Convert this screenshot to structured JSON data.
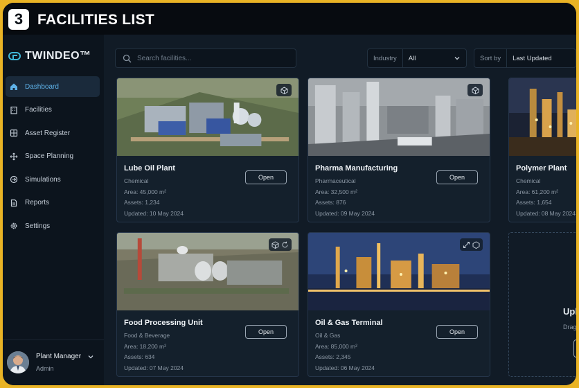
{
  "slide": {
    "step": "3",
    "title": "FACILITIES LIST"
  },
  "brand": {
    "name": "TWINDEO™"
  },
  "nav": [
    {
      "label": "Dashboard",
      "icon": "home-icon",
      "active": true
    },
    {
      "label": "Facilities",
      "icon": "building-icon",
      "active": false
    },
    {
      "label": "Asset Register",
      "icon": "database-icon",
      "active": false
    },
    {
      "label": "Space Planning",
      "icon": "expand-icon",
      "active": false
    },
    {
      "label": "Simulations",
      "icon": "simulation-icon",
      "active": false
    },
    {
      "label": "Reports",
      "icon": "document-icon",
      "active": false
    },
    {
      "label": "Settings",
      "icon": "gear-icon",
      "active": false
    }
  ],
  "user": {
    "name": "Plant Manager",
    "role": "Admin"
  },
  "search": {
    "placeholder": "Search facilities..."
  },
  "filters": {
    "industry": {
      "label": "Industry",
      "value": "All"
    },
    "sort": {
      "label": "Sort by",
      "value": "Last Updated"
    }
  },
  "open_label": "Open",
  "cards": [
    {
      "title": "Lube Oil Plant",
      "category": "Chemical",
      "area": "Area: 45,000 m²",
      "assets": "Assets: 1,234",
      "updated": "Updated: 10 May 2024",
      "badge_icon": "cube-icon"
    },
    {
      "title": "Pharma Manufacturing",
      "category": "Pharmaceutical",
      "area": "Area: 32,500 m²",
      "assets": "Assets: 876",
      "updated": "Updated: 09 May 2024",
      "badge_icon": "cube-icon"
    },
    {
      "title": "Polymer Plant",
      "category": "Chemical",
      "area": "Area: 61,200 m²",
      "assets": "Assets: 1,654",
      "updated": "Updated: 08 May 2024",
      "badge_icon": "cube-icon"
    },
    {
      "title": "Food Processing Unit",
      "category": "Food & Beverage",
      "area": "Area: 18,200 m²",
      "assets": "Assets: 634",
      "updated": "Updated: 07 May 2024",
      "badge_icon": "cube-icon"
    },
    {
      "title": "Oil & Gas Terminal",
      "category": "Oil & Gas",
      "area": "Area: 85,000 m²",
      "assets": "Assets: 2,345",
      "updated": "Updated: 06 May 2024",
      "badge_icon": "cube-icon"
    }
  ],
  "upload": {
    "title": "Upl",
    "subtitle": "Drag"
  },
  "colors": {
    "accent": "#5fb3ea",
    "frame": "#e9b325",
    "background": "#0a1018"
  }
}
